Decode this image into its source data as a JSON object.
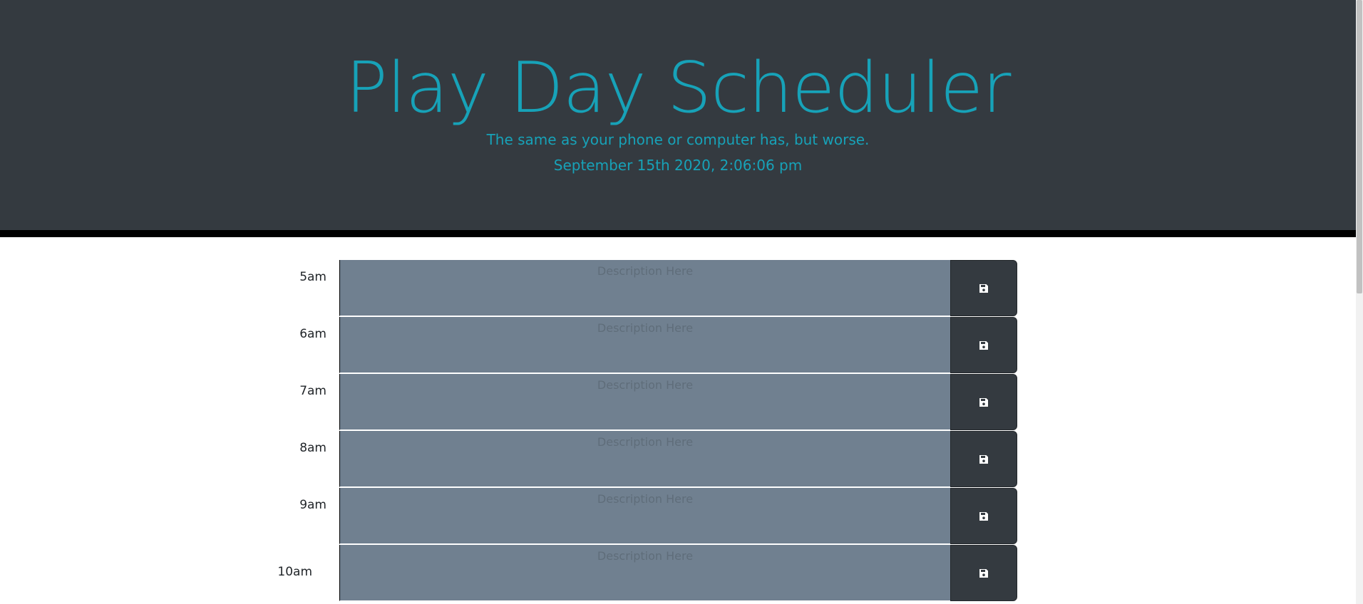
{
  "header": {
    "title": "Play Day Scheduler",
    "subtitle": "The same as your phone or computer has, but worse.",
    "current_day": "September 15th 2020, 2:06:06 pm"
  },
  "colors": {
    "header_bg": "#343a40",
    "accent": "#17a2b8",
    "past_block": "#708090",
    "save_button": "#343a40"
  },
  "schedule": {
    "placeholder": "Description Here",
    "save_icon": "floppy-disk-icon",
    "rows": [
      {
        "hour": "5am",
        "text": ""
      },
      {
        "hour": "6am",
        "text": ""
      },
      {
        "hour": "7am",
        "text": ""
      },
      {
        "hour": "8am",
        "text": ""
      },
      {
        "hour": "9am",
        "text": ""
      },
      {
        "hour": "10am",
        "text": ""
      }
    ]
  }
}
